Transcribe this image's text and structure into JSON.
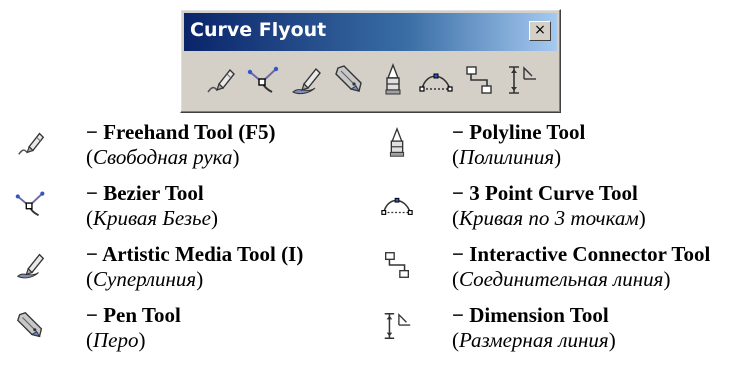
{
  "flyout": {
    "title": "Curve Flyout",
    "close_glyph": "×",
    "tools": [
      {
        "icon": "freehand-icon"
      },
      {
        "icon": "bezier-icon"
      },
      {
        "icon": "artistic-media-icon"
      },
      {
        "icon": "pen-icon"
      },
      {
        "icon": "polyline-icon"
      },
      {
        "icon": "3-point-curve-icon"
      },
      {
        "icon": "interactive-connector-icon"
      },
      {
        "icon": "dimension-icon"
      }
    ]
  },
  "legend": {
    "dash": "− ",
    "open_paren": "(",
    "close_paren": ")",
    "items": [
      {
        "name": "Freehand Tool",
        "shortcut": "F5",
        "ru": "Свободная рука"
      },
      {
        "name": "Bezier Tool",
        "ru": "Кривая Безье"
      },
      {
        "name": "Artistic Media Tool",
        "shortcut": "I",
        "ru": "Суперлиния"
      },
      {
        "name": "Pen Tool",
        "ru": "Перо"
      },
      {
        "name": "Polyline Tool",
        "ru": "Полилиния"
      },
      {
        "name": "3 Point Curve Tool",
        "ru": "Кривая по 3 точкам"
      },
      {
        "name": "Interactive Connector Tool",
        "ru": "Соединительная линия"
      },
      {
        "name": "Dimension Tool",
        "ru": "Размерная линия"
      }
    ]
  }
}
